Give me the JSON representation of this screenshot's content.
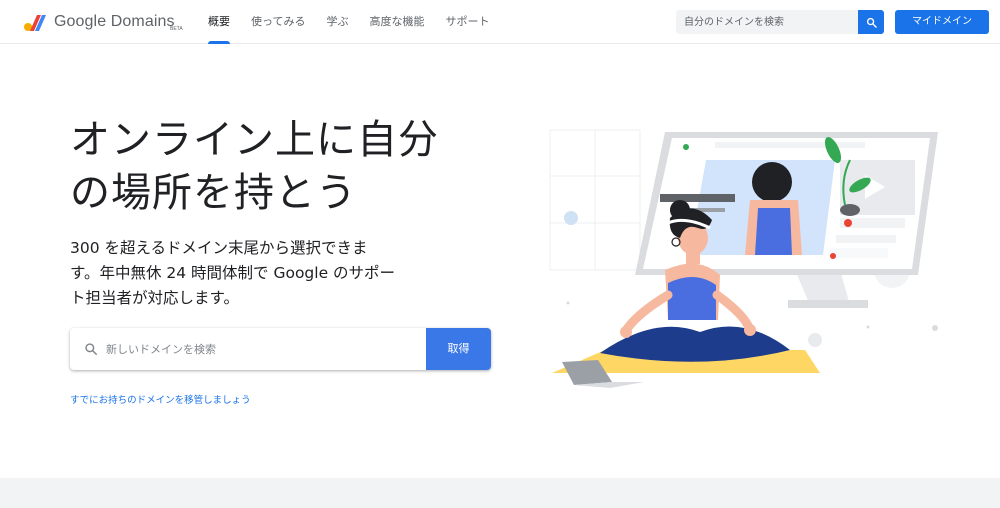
{
  "header": {
    "brand": "Google Domains",
    "beta": "BETA",
    "nav": [
      {
        "label": "概要",
        "active": true
      },
      {
        "label": "使ってみる",
        "active": false
      },
      {
        "label": "学ぶ",
        "active": false
      },
      {
        "label": "高度な機能",
        "active": false
      },
      {
        "label": "サポート",
        "active": false
      }
    ],
    "search_placeholder": "自分のドメインを検索",
    "my_domains_label": "マイドメイン"
  },
  "hero": {
    "headline_line1": "オンライン上に自分",
    "headline_line2": "の場所を持とう",
    "subtext_line1": "300 を超えるドメイン末尾から選択できま",
    "subtext_line2": "す。年中無休 24 時間体制で Google のサポー",
    "subtext_line3": "ト担当者が対応します。",
    "search_placeholder": "新しいドメインを検索",
    "get_label": "取得",
    "transfer_link": "すでにお持ちのドメインを移管しましょう"
  },
  "colors": {
    "accent": "#1a73e8",
    "button": "#3b78e7",
    "mat": "#fdd663",
    "outfit": "#4a6ee0",
    "pants": "#1e3c8c"
  }
}
